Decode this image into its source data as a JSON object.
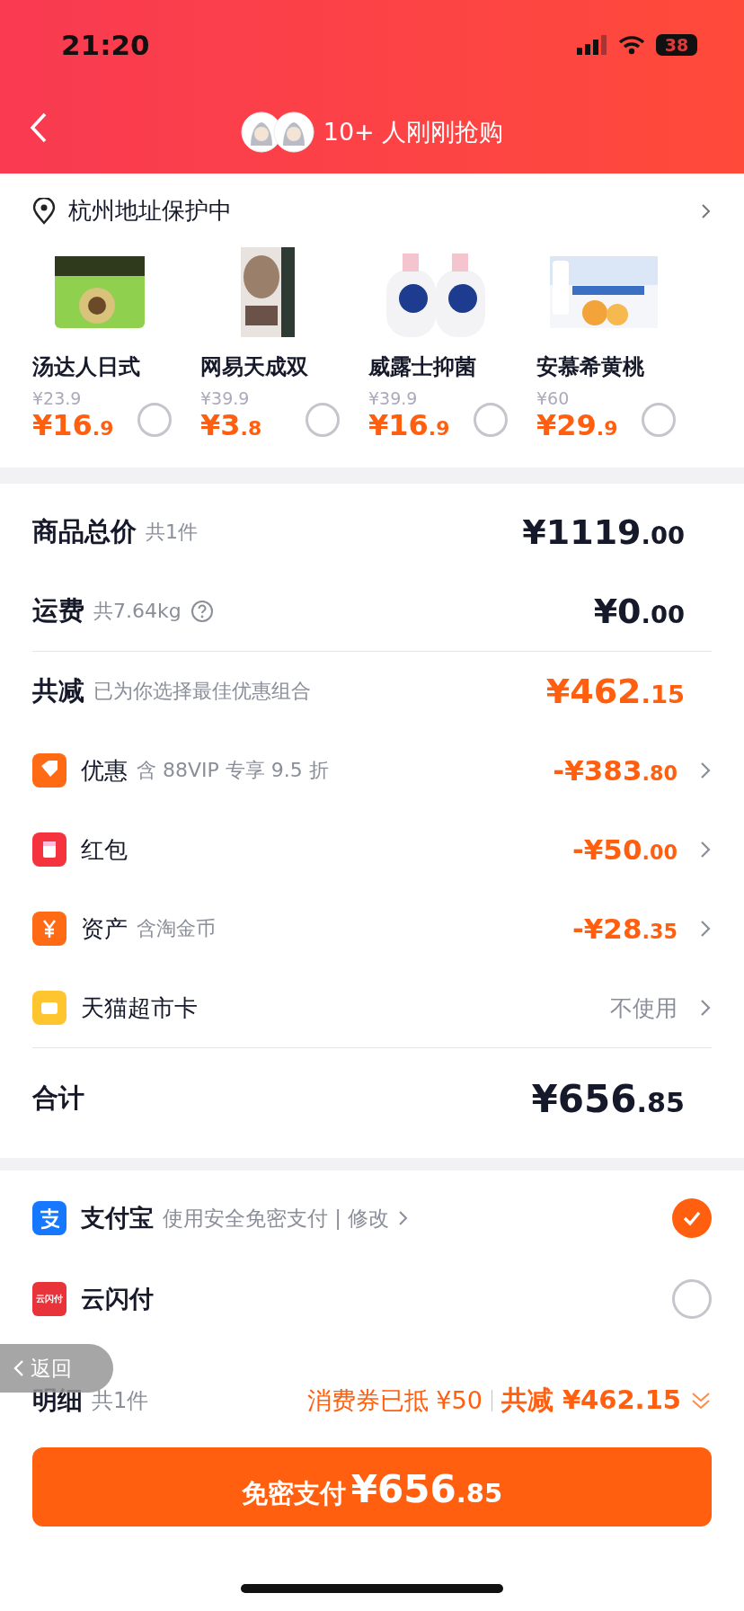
{
  "status_bar": {
    "time": "21:20",
    "battery": "38"
  },
  "header": {
    "title": "10+ 人刚刚抢购"
  },
  "address": {
    "label": "杭州地址保护中"
  },
  "products": [
    {
      "name": "汤达人日式",
      "original_price": "¥23.9",
      "price_main": "¥16",
      "price_cents": ".9",
      "selected": false
    },
    {
      "name": "网易天成双",
      "original_price": "¥39.9",
      "price_main": "¥3",
      "price_cents": ".8",
      "selected": false
    },
    {
      "name": "威露士抑菌",
      "original_price": "¥39.9",
      "price_main": "¥16",
      "price_cents": ".9",
      "selected": false
    },
    {
      "name": "安慕希黄桃",
      "original_price": "¥60",
      "price_main": "¥29",
      "price_cents": ".9",
      "selected": false
    }
  ],
  "summary": {
    "rows": [
      {
        "title": "商品总价",
        "note": "共1件",
        "amount_main": "¥1119",
        "amount_cents": ".00",
        "help": false
      },
      {
        "title": "运费",
        "note": "共7.64kg",
        "amount_main": "¥0",
        "amount_cents": ".00",
        "help": true
      }
    ],
    "discount": {
      "title": "共减",
      "note": "已为你选择最佳优惠组合",
      "amount_main": "¥462",
      "amount_cents": ".15"
    },
    "discount_items": [
      {
        "kind": "tag",
        "color": "#ff6a14",
        "title": "优惠",
        "note": "含 88VIP 专享 9.5 折",
        "value_main": "-¥383",
        "value_cents": ".80"
      },
      {
        "kind": "packet",
        "color": "#f5333f",
        "title": "红包",
        "value_main": "-¥50",
        "value_cents": ".00"
      },
      {
        "kind": "coin",
        "color": "#ff6a14",
        "title": "资产",
        "note": "含淘金币",
        "value_main": "-¥28",
        "value_cents": ".35"
      },
      {
        "kind": "card",
        "color": "#ffc52e",
        "title": "天猫超市卡",
        "status": "不使用"
      }
    ],
    "total": {
      "title": "合计",
      "amount_main": "¥656",
      "amount_cents": ".85"
    }
  },
  "payment_methods": [
    {
      "kind": "alipay",
      "name": "支付宝",
      "note": "使用安全免密支付 | 修改",
      "selected": true
    },
    {
      "kind": "unionpay",
      "name": "云闪付",
      "badge": "云闪付",
      "selected": false
    }
  ],
  "footer": {
    "title": "明细",
    "count": "共1件",
    "voucher": "消费券已抵 ¥50",
    "saving": "共减 ¥462.15",
    "button_label": "免密支付",
    "button_main": "¥656",
    "button_cents": ".85"
  },
  "back_pill": {
    "label": "返回"
  }
}
